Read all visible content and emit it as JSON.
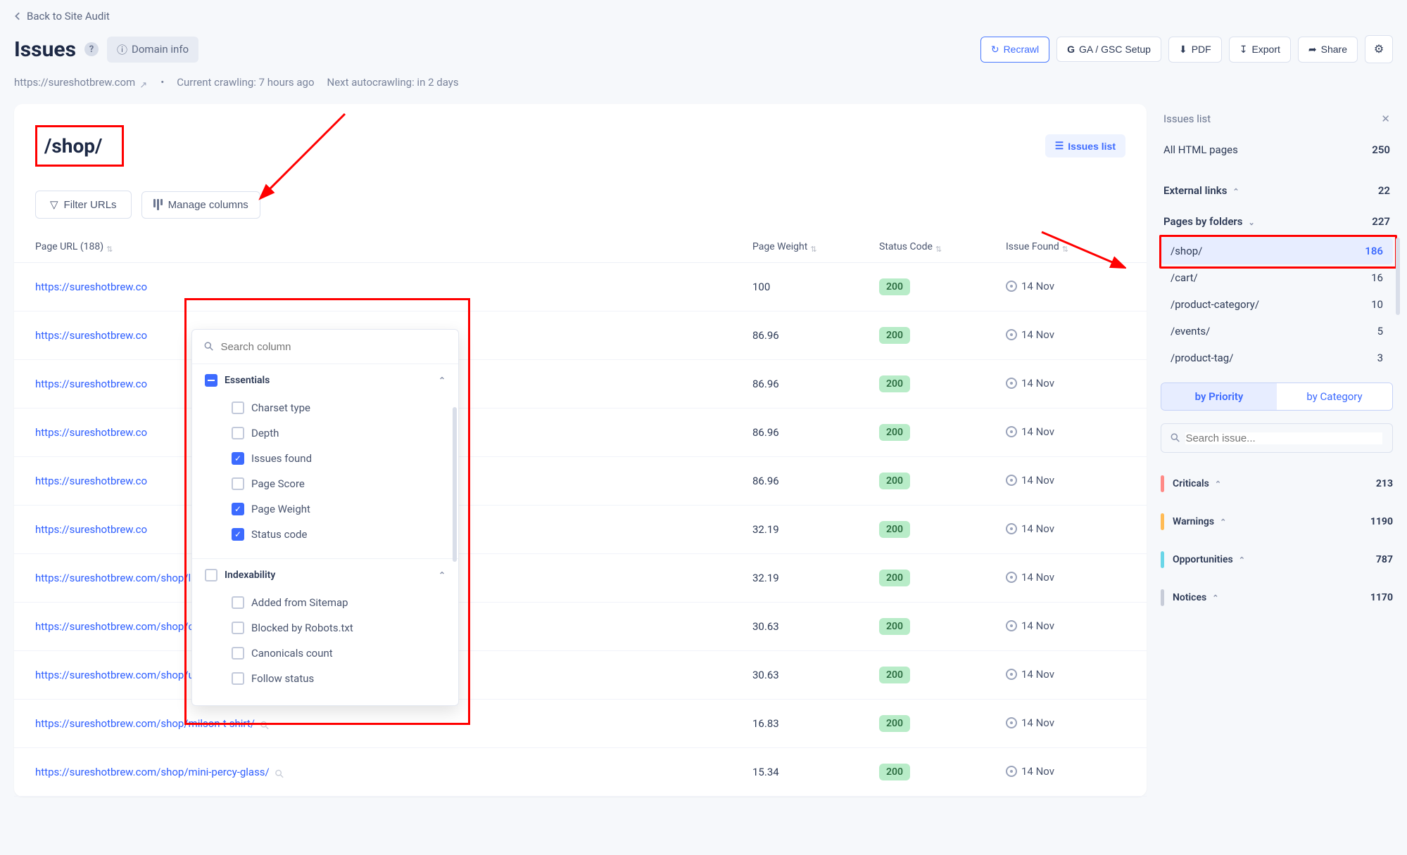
{
  "header": {
    "back_label": "Back to Site Audit",
    "page_title": "Issues",
    "domain_info_label": "Domain info",
    "site_url": "https://sureshotbrew.com",
    "crawling_text": "Current crawling: 7 hours ago",
    "autocrawl_text": "Next autocrawling: in 2 days",
    "actions": {
      "recrawl": "Recrawl",
      "ga_gsc": "GA / GSC Setup",
      "pdf": "PDF",
      "export": "Export",
      "share": "Share"
    }
  },
  "main": {
    "folder_title": "/shop/",
    "issues_list_label": "Issues list",
    "filter_urls_label": "Filter URLs",
    "manage_columns_label": "Manage columns",
    "columns_dropdown": {
      "search_placeholder": "Search column",
      "groups": [
        {
          "name": "Essentials",
          "items": [
            {
              "label": "Charset type",
              "checked": false
            },
            {
              "label": "Depth",
              "checked": false
            },
            {
              "label": "Issues found",
              "checked": true
            },
            {
              "label": "Page Score",
              "checked": false
            },
            {
              "label": "Page Weight",
              "checked": true
            },
            {
              "label": "Status code",
              "checked": true
            }
          ]
        },
        {
          "name": "Indexability",
          "items": [
            {
              "label": "Added from Sitemap",
              "checked": false
            },
            {
              "label": "Blocked by Robots.txt",
              "checked": false
            },
            {
              "label": "Canonicals count",
              "checked": false
            },
            {
              "label": "Follow status",
              "checked": false
            }
          ]
        }
      ]
    },
    "table": {
      "headers": {
        "url": "Page URL (188)",
        "weight": "Page Weight",
        "code": "Status Code",
        "issue": "Issue Found"
      },
      "rows": [
        {
          "url": "https://sureshotbrew.co",
          "truncated": true,
          "weight": "100",
          "code": "200",
          "date": "14 Nov"
        },
        {
          "url": "https://sureshotbrew.co",
          "truncated": true,
          "weight": "86.96",
          "code": "200",
          "date": "14 Nov"
        },
        {
          "url": "https://sureshotbrew.co",
          "truncated": true,
          "weight": "86.96",
          "code": "200",
          "date": "14 Nov"
        },
        {
          "url": "https://sureshotbrew.co",
          "truncated": true,
          "weight": "86.96",
          "code": "200",
          "date": "14 Nov"
        },
        {
          "url": "https://sureshotbrew.co",
          "truncated": true,
          "weight": "86.96",
          "code": "200",
          "date": "14 Nov"
        },
        {
          "url": "https://sureshotbrew.co",
          "truncated": true,
          "weight": "32.19",
          "code": "200",
          "date": "14 Nov"
        },
        {
          "url": "https://sureshotbrew.com/shop/land-of-arches/",
          "truncated": false,
          "weight": "32.19",
          "code": "200",
          "date": "14 Nov"
        },
        {
          "url": "https://sureshotbrew.com/shop/collab-case/",
          "truncated": false,
          "weight": "30.63",
          "code": "200",
          "date": "14 Nov"
        },
        {
          "url": "https://sureshotbrew.com/shop/ultimate-collab-case/",
          "truncated": false,
          "weight": "30.63",
          "code": "200",
          "date": "14 Nov"
        },
        {
          "url": "https://sureshotbrew.com/shop/milson-t-shirt/",
          "truncated": false,
          "weight": "16.83",
          "code": "200",
          "date": "14 Nov"
        },
        {
          "url": "https://sureshotbrew.com/shop/mini-percy-glass/",
          "truncated": false,
          "weight": "15.34",
          "code": "200",
          "date": "14 Nov"
        }
      ]
    }
  },
  "side": {
    "issues_list_label": "Issues list",
    "all_pages_label": "All HTML pages",
    "all_pages_count": "250",
    "external_links_label": "External links",
    "external_links_count": "22",
    "pages_by_folders_label": "Pages by folders",
    "pages_by_folders_count": "227",
    "folders": [
      {
        "name": "/shop/",
        "count": "186",
        "active": true
      },
      {
        "name": "/cart/",
        "count": "16",
        "active": false
      },
      {
        "name": "/product-category/",
        "count": "10",
        "active": false
      },
      {
        "name": "/events/",
        "count": "5",
        "active": false
      },
      {
        "name": "/product-tag/",
        "count": "3",
        "active": false
      }
    ],
    "by_priority_label": "by Priority",
    "by_category_label": "by Category",
    "search_issue_placeholder": "Search issue...",
    "categories": [
      {
        "label": "Criticals",
        "count": "213",
        "color": "#ff8a86"
      },
      {
        "label": "Warnings",
        "count": "1190",
        "color": "#ffbb55"
      },
      {
        "label": "Opportunities",
        "count": "787",
        "color": "#6ad6e8"
      },
      {
        "label": "Notices",
        "count": "1170",
        "color": "#c7ccd8"
      }
    ]
  }
}
